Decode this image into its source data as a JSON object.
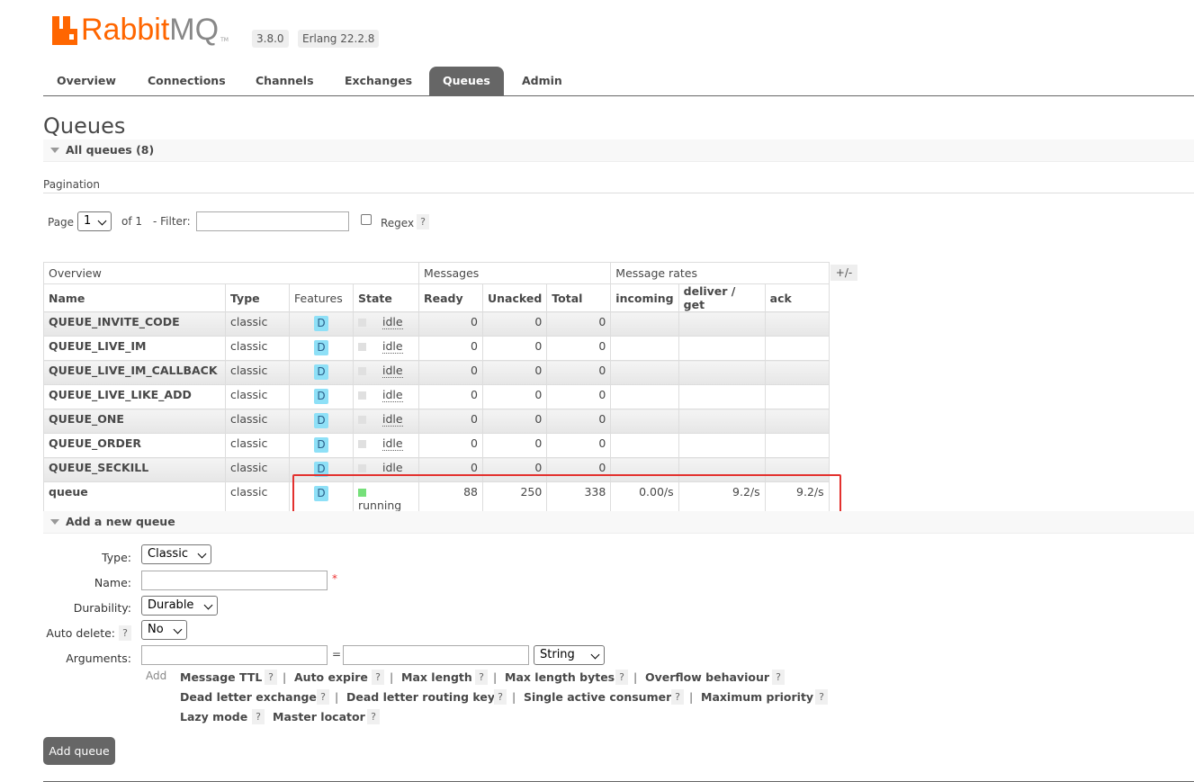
{
  "header": {
    "brand_rabbit": "Rabbit",
    "brand_mq": "MQ",
    "trademark": "TM",
    "version": "3.8.0",
    "erlang": "Erlang 22.2.8"
  },
  "tabs": [
    {
      "label": "Overview"
    },
    {
      "label": "Connections"
    },
    {
      "label": "Channels"
    },
    {
      "label": "Exchanges"
    },
    {
      "label": "Queues"
    },
    {
      "label": "Admin"
    }
  ],
  "page_title": "Queues",
  "all_queues_label": "All queues (8)",
  "pagination": {
    "section_label": "Pagination",
    "page_label": "Page",
    "page_value": "1",
    "of_label": "of 1",
    "filter_label": "- Filter:",
    "filter_value": "",
    "regex_label": "Regex",
    "help": "?"
  },
  "table": {
    "group_headers": [
      "Overview",
      "Messages",
      "Message rates"
    ],
    "columns": [
      "Name",
      "Type",
      "Features",
      "State",
      "Ready",
      "Unacked",
      "Total",
      "incoming",
      "deliver / get",
      "ack"
    ],
    "plus_minus": "+/-",
    "rows": [
      {
        "name": "QUEUE_INVITE_CODE",
        "type": "classic",
        "feature": "D",
        "state": "idle",
        "ready": "0",
        "unacked": "0",
        "total": "0",
        "incoming": "",
        "deliver": "",
        "ack": ""
      },
      {
        "name": "QUEUE_LIVE_IM",
        "type": "classic",
        "feature": "D",
        "state": "idle",
        "ready": "0",
        "unacked": "0",
        "total": "0",
        "incoming": "",
        "deliver": "",
        "ack": ""
      },
      {
        "name": "QUEUE_LIVE_IM_CALLBACK",
        "type": "classic",
        "feature": "D",
        "state": "idle",
        "ready": "0",
        "unacked": "0",
        "total": "0",
        "incoming": "",
        "deliver": "",
        "ack": ""
      },
      {
        "name": "QUEUE_LIVE_LIKE_ADD",
        "type": "classic",
        "feature": "D",
        "state": "idle",
        "ready": "0",
        "unacked": "0",
        "total": "0",
        "incoming": "",
        "deliver": "",
        "ack": ""
      },
      {
        "name": "QUEUE_ONE",
        "type": "classic",
        "feature": "D",
        "state": "idle",
        "ready": "0",
        "unacked": "0",
        "total": "0",
        "incoming": "",
        "deliver": "",
        "ack": ""
      },
      {
        "name": "QUEUE_ORDER",
        "type": "classic",
        "feature": "D",
        "state": "idle",
        "ready": "0",
        "unacked": "0",
        "total": "0",
        "incoming": "",
        "deliver": "",
        "ack": ""
      },
      {
        "name": "QUEUE_SECKILL",
        "type": "classic",
        "feature": "D",
        "state": "idle",
        "ready": "0",
        "unacked": "0",
        "total": "0",
        "incoming": "",
        "deliver": "",
        "ack": ""
      },
      {
        "name": "queue",
        "type": "classic",
        "feature": "D",
        "state": "running",
        "ready": "88",
        "unacked": "250",
        "total": "338",
        "incoming": "0.00/s",
        "deliver": "9.2/s",
        "ack": "9.2/s"
      }
    ]
  },
  "add_queue": {
    "section_label": "Add a new queue",
    "type_label": "Type:",
    "type_value": "Classic",
    "name_label": "Name:",
    "name_value": "",
    "required_mark": "*",
    "durability_label": "Durability:",
    "durability_value": "Durable",
    "auto_delete_label": "Auto delete:",
    "auto_delete_value": "No",
    "arguments_label": "Arguments:",
    "equals": "=",
    "arg_type_value": "String",
    "add_label": "Add",
    "arg_links": [
      "Message TTL",
      "Auto expire",
      "Max length",
      "Max length bytes",
      "Overflow behaviour",
      "Dead letter exchange",
      "Dead letter routing key",
      "Single active consumer",
      "Maximum priority",
      "Lazy mode",
      "Master locator"
    ],
    "separator": "|",
    "submit_label": "Add queue"
  },
  "colors": {
    "brand_orange": "#ff6600",
    "tab_active": "#666666",
    "durable_badge": "#8ee0f7",
    "running": "#76e07a",
    "highlight": "#e3312e"
  }
}
